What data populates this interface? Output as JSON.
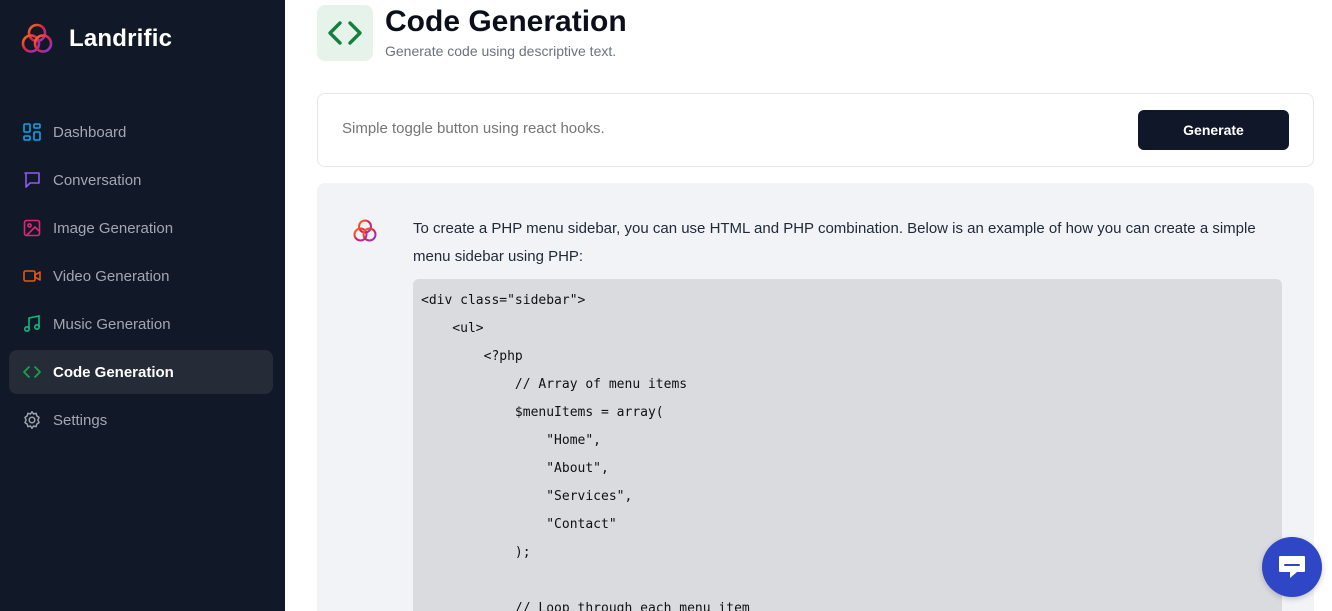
{
  "brand": {
    "name": "Landrific"
  },
  "sidebar": {
    "items": [
      {
        "label": "Dashboard",
        "icon": "dashboard-icon",
        "color": "#0ea5e9"
      },
      {
        "label": "Conversation",
        "icon": "chat-icon",
        "color": "#8b5cf6"
      },
      {
        "label": "Image Generation",
        "icon": "image-icon",
        "color": "#db2777"
      },
      {
        "label": "Video Generation",
        "icon": "video-icon",
        "color": "#ea580c"
      },
      {
        "label": "Music Generation",
        "icon": "music-icon",
        "color": "#10b981"
      },
      {
        "label": "Code Generation",
        "icon": "code-icon",
        "color": "#16a34a",
        "active": true
      },
      {
        "label": "Settings",
        "icon": "gear-icon",
        "color": "#9ca3af"
      }
    ]
  },
  "header": {
    "title": "Code Generation",
    "subtitle": "Generate code using descriptive text.",
    "icon": "code-icon",
    "icon_color": "#15803d"
  },
  "prompt": {
    "placeholder": "Simple toggle button using react hooks.",
    "value": "",
    "button_label": "Generate"
  },
  "response": {
    "text": "To create a PHP menu sidebar, you can use HTML and PHP combination. Below is an example of how you can create a simple menu sidebar using PHP:",
    "code_lines": [
      "<div class=\"sidebar\">",
      "    <ul>",
      "        <?php",
      "            // Array of menu items",
      "            $menuItems = array(",
      "                \"Home\",",
      "                \"About\",",
      "                \"Services\",",
      "                \"Contact\"",
      "            );",
      "",
      "            // Loop through each menu item"
    ]
  },
  "colors": {
    "sidebar_bg": "#111827",
    "accent_button": "#0f1729",
    "chat_fab": "#2f47c6"
  }
}
